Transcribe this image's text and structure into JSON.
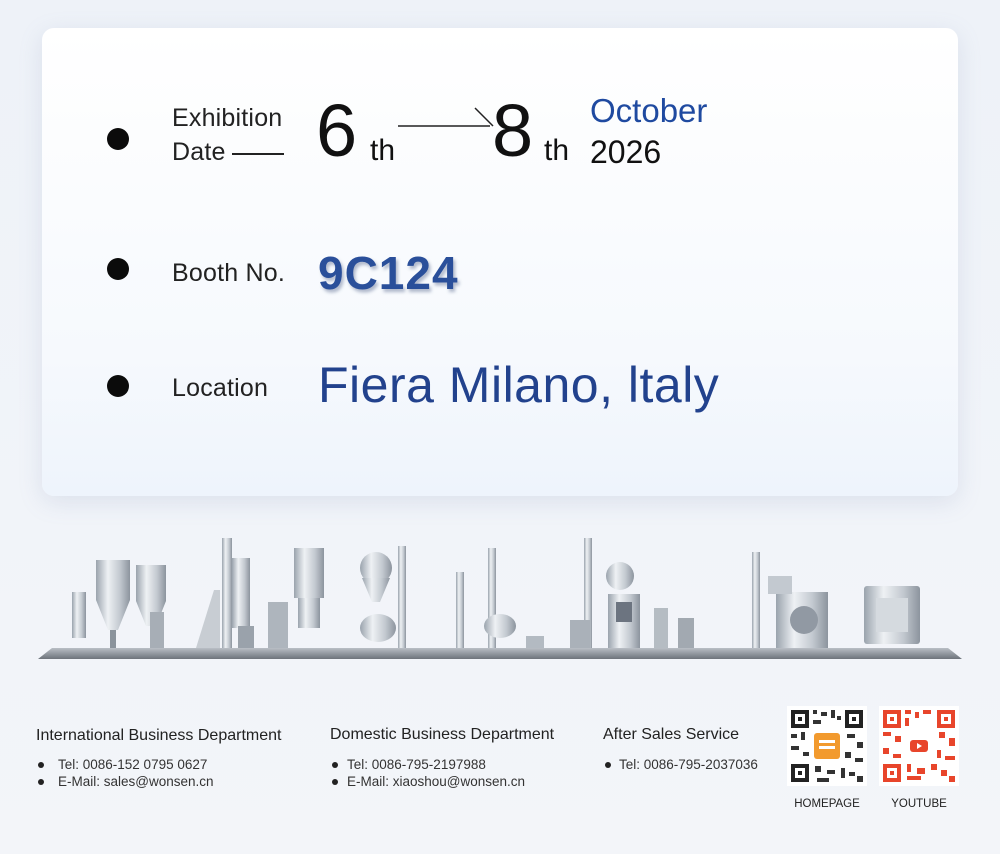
{
  "exhibition": {
    "date_label_line1": "Exhibition",
    "date_label_line2": "Date",
    "start_day": "6",
    "start_suffix": "th",
    "end_day": "8",
    "end_suffix": "th",
    "month": "October",
    "year": "2026",
    "booth_label": "Booth No.",
    "booth_value": "9C124",
    "location_label": "Location",
    "location_value": "Fiera Milano, ltaly"
  },
  "footer": {
    "international": {
      "title": "International Business Department",
      "tel": "Tel: 0086-152 0795 0627",
      "email": "E-Mail: sales@wonsen.cn"
    },
    "domestic": {
      "title": "Domestic Business Department",
      "tel": "Tel: 0086-795-2197988",
      "email": "E-Mail: xiaoshou@wonsen.cn"
    },
    "after_sales": {
      "title": "After Sales Service",
      "tel": "Tel: 0086-795-2037036"
    },
    "qr_homepage_caption": "HOMEPAGE",
    "qr_youtube_caption": "YOUTUBE"
  },
  "colors": {
    "accent_blue": "#1f4aa0",
    "youtube_red": "#e8452b",
    "homepage_badge": "#f29a2e"
  },
  "icons": [
    "bullet-icon",
    "arrow-line-icon",
    "qr-code-icon",
    "youtube-play-icon"
  ]
}
